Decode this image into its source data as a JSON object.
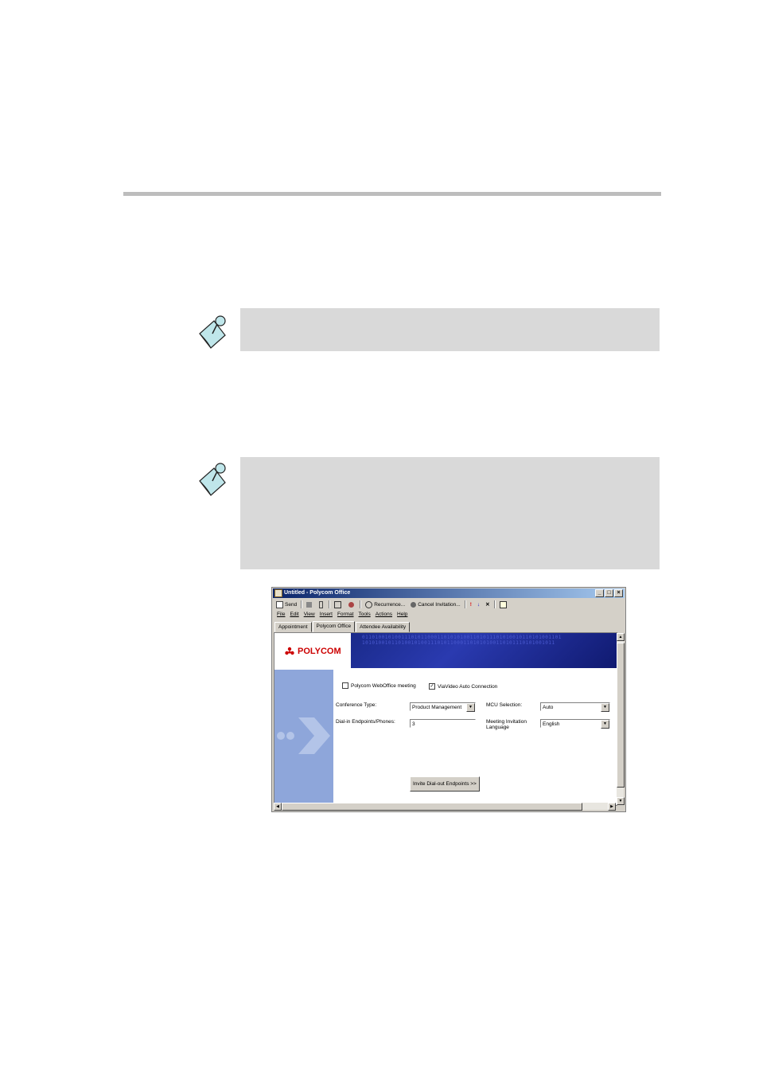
{
  "window": {
    "title": "Untitled - Polycom Office",
    "controls": [
      "_",
      "□",
      "×"
    ]
  },
  "toolbar": {
    "send": "Send",
    "recurrence": "Recurrence...",
    "cancel_invitation": "Cancel Invitation..."
  },
  "menu": [
    "File",
    "Edit",
    "View",
    "Insert",
    "Format",
    "Tools",
    "Actions",
    "Help"
  ],
  "tabs": [
    "Appointment",
    "Polycom Office",
    "Attendee Availability"
  ],
  "active_tab": "Polycom Office",
  "banner": {
    "logo_text": "POLYCOM",
    "binary": "0110100101001110101100011010101001101011101010010110101001101",
    "binary2": "10101001011010010100111010110001101010100110101110101001011"
  },
  "form": {
    "webofficeMeeting": {
      "label": "Polycom WebOffice meeting",
      "checked": false
    },
    "viavideo": {
      "label": "ViaVideo Auto Connection",
      "checked": true,
      "mark": "✓"
    },
    "conference_type": {
      "label": "Conference Type:",
      "value": "Product Management"
    },
    "mcu_selection": {
      "label": "MCU Selection:",
      "value": "Auto"
    },
    "dialin": {
      "label": "Dial-in Endpoints/Phones:",
      "value": "3"
    },
    "language": {
      "label": "Meeting Invitation Language",
      "value": "English"
    },
    "invite_button": "Invite Dial-out Endpoints >>"
  },
  "colors": {
    "note_bg": "#d9d9d9",
    "rule": "#bdbdbd",
    "banner_blue": "#1a2a8a",
    "left_panel": "#8ea6da"
  }
}
